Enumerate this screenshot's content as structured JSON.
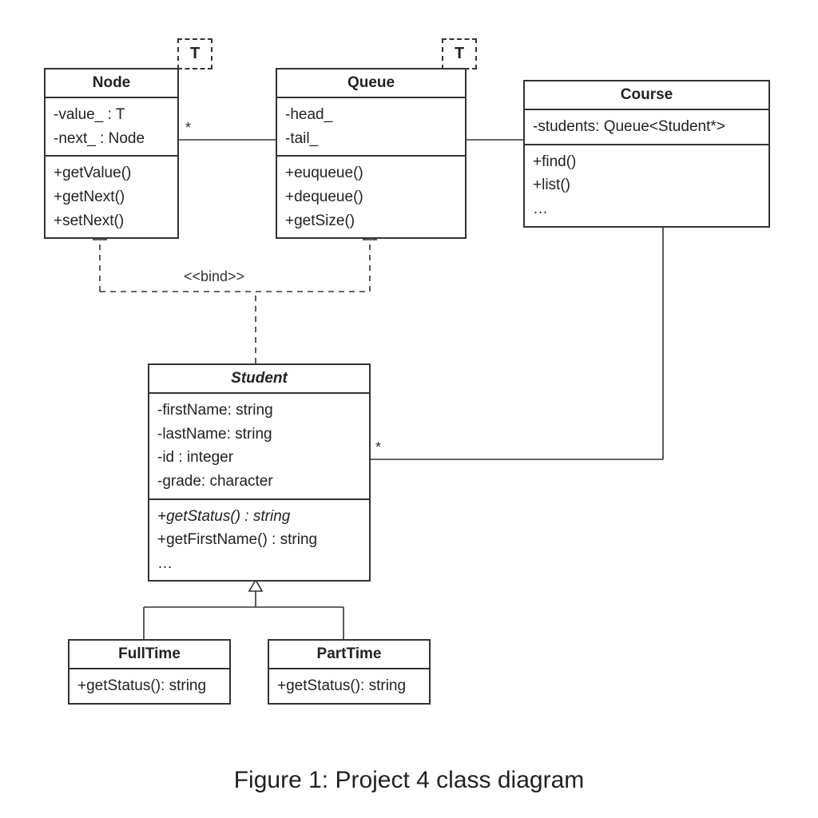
{
  "caption": "Figure 1: Project 4 class diagram",
  "templateParam": "T",
  "bindLabel": "<<bind>>",
  "multiplicity": "*",
  "classes": {
    "node": {
      "title": "Node",
      "attrs": [
        "-value_ : T",
        "-next_ : Node"
      ],
      "ops": [
        "+getValue()",
        "+getNext()",
        "+setNext()"
      ]
    },
    "queue": {
      "title": "Queue",
      "attrs": [
        "-head_",
        "-tail_"
      ],
      "ops": [
        "+euqueue()",
        "+dequeue()",
        "+getSize()"
      ]
    },
    "course": {
      "title": "Course",
      "attrs": [
        "-students: Queue<Student*>"
      ],
      "ops": [
        "+find()",
        "+list()",
        "…"
      ]
    },
    "student": {
      "title": "Student",
      "attrs": [
        "-firstName: string",
        "-lastName: string",
        "-id : integer",
        "-grade: character"
      ],
      "ops": [
        {
          "text": "+getStatus() : string",
          "italic": true
        },
        {
          "text": "+getFirstName() : string"
        },
        {
          "text": "…"
        }
      ]
    },
    "fulltime": {
      "title": "FullTime",
      "ops": [
        "+getStatus(): string"
      ]
    },
    "parttime": {
      "title": "PartTime",
      "ops": [
        "+getStatus(): string"
      ]
    }
  },
  "chart_data": {
    "type": "uml-class-diagram",
    "classes": [
      {
        "name": "Node",
        "template": "T",
        "attributes": [
          "-value_ : T",
          "-next_ : Node"
        ],
        "operations": [
          "+getValue()",
          "+getNext()",
          "+setNext()"
        ]
      },
      {
        "name": "Queue",
        "template": "T",
        "attributes": [
          "-head_",
          "-tail_"
        ],
        "operations": [
          "+euqueue()",
          "+dequeue()",
          "+getSize()"
        ]
      },
      {
        "name": "Course",
        "attributes": [
          "-students: Queue<Student*>"
        ],
        "operations": [
          "+find()",
          "+list()",
          "…"
        ]
      },
      {
        "name": "Student",
        "abstract": true,
        "attributes": [
          "-firstName: string",
          "-lastName: string",
          "-id : integer",
          "-grade: character"
        ],
        "operations": [
          "+getStatus() : string",
          "+getFirstName() : string",
          "…"
        ]
      },
      {
        "name": "FullTime",
        "operations": [
          "+getStatus(): string"
        ]
      },
      {
        "name": "PartTime",
        "operations": [
          "+getStatus(): string"
        ]
      }
    ],
    "relationships": [
      {
        "from": "Queue",
        "to": "Node",
        "type": "composition",
        "multiplicity_to": "*"
      },
      {
        "from": "Course",
        "to": "Queue",
        "type": "aggregation"
      },
      {
        "from": "Course",
        "to": "Student",
        "type": "association",
        "multiplicity_to": "*"
      },
      {
        "from": "Student",
        "to": "Node",
        "type": "bind",
        "stereotype": "<<bind>>"
      },
      {
        "from": "Student",
        "to": "Queue",
        "type": "bind",
        "stereotype": "<<bind>>"
      },
      {
        "from": "FullTime",
        "to": "Student",
        "type": "generalization"
      },
      {
        "from": "PartTime",
        "to": "Student",
        "type": "generalization"
      }
    ],
    "caption": "Figure 1: Project 4 class diagram"
  }
}
